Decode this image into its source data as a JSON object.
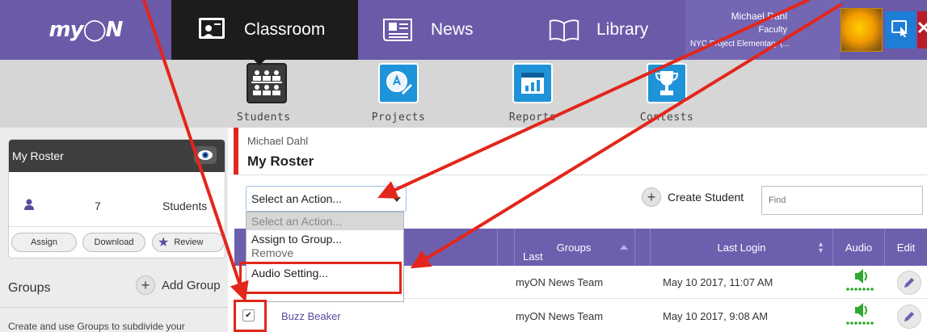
{
  "brand": {
    "logo": "my◯N"
  },
  "nav": {
    "items": [
      {
        "label": "Classroom",
        "icon": "classroom-board-icon",
        "active": true
      },
      {
        "label": "News",
        "icon": "newspaper-icon"
      },
      {
        "label": "Library",
        "icon": "open-book-icon"
      }
    ]
  },
  "user": {
    "name": "Michael Dahl",
    "role": "Faculty",
    "school": "NYC Project Elementary (..."
  },
  "subnav": {
    "items": [
      {
        "label": "Students",
        "icon": "students-icon",
        "color": "#3b3b3b"
      },
      {
        "label": "Projects",
        "icon": "projects-icon",
        "color": "#1f93d8"
      },
      {
        "label": "Reports",
        "icon": "reports-icon",
        "color": "#1f93d8"
      },
      {
        "label": "Contests",
        "icon": "contests-trophy-icon",
        "color": "#1f93d8"
      }
    ]
  },
  "sidebar": {
    "roster_title": "My Roster",
    "student_count": "7",
    "students_label": "Students",
    "buttons": {
      "assign": "Assign",
      "download": "Download",
      "review": "Review"
    },
    "groups_title": "Groups",
    "add_group": "Add Group",
    "groups_description": "Create and use Groups to subdivide your"
  },
  "main": {
    "teacher": "Michael Dahl",
    "title": "My Roster",
    "action_select": {
      "value": "Select an Action...",
      "options": [
        "Select an Action...",
        "Assign to Group...",
        "Remove",
        "Audio Setting..."
      ]
    },
    "create_student": "Create Student",
    "find_placeholder": "Find",
    "table": {
      "headers": {
        "last": "Last",
        "groups": "Groups",
        "last_login": "Last Login",
        "audio": "Audio",
        "edit": "Edit"
      },
      "rows": [
        {
          "name": "",
          "group": "myON News Team",
          "last_login": "May 10 2017, 11:07 AM",
          "checked": false
        },
        {
          "name": "Buzz Beaker",
          "group": "myON News Team",
          "last_login": "May 10 2017, 9:08 AM",
          "checked": true
        }
      ]
    }
  },
  "colors": {
    "nav_purple": "#6a5aa8",
    "highlight_red": "#e3261b",
    "accent_blue": "#1f93d8"
  }
}
